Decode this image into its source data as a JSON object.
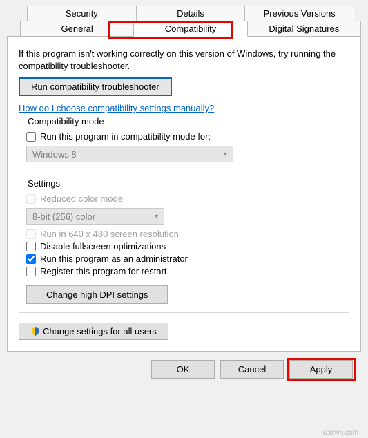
{
  "tabs": {
    "row1": [
      "Security",
      "Details",
      "Previous Versions"
    ],
    "row2": [
      "General",
      "Compatibility",
      "Digital Signatures"
    ],
    "active": "Compatibility"
  },
  "intro": "If this program isn't working correctly on this version of Windows, try running the compatibility troubleshooter.",
  "troubleshooter_btn": "Run compatibility troubleshooter",
  "manual_link": "How do I choose compatibility settings manually?",
  "compat_mode": {
    "group_title": "Compatibility mode",
    "check_label": "Run this program in compatibility mode for:",
    "check_value": false,
    "combo_value": "Windows 8"
  },
  "settings": {
    "group_title": "Settings",
    "reduced_color": {
      "label": "Reduced color mode",
      "checked": false,
      "enabled": false
    },
    "color_combo": "8-bit (256) color",
    "res_640": {
      "label": "Run in 640 x 480 screen resolution",
      "checked": false,
      "enabled": false
    },
    "disable_fullscreen": {
      "label": "Disable fullscreen optimizations",
      "checked": false,
      "enabled": true
    },
    "run_admin": {
      "label": "Run this program as an administrator",
      "checked": true,
      "enabled": true
    },
    "register_restart": {
      "label": "Register this program for restart",
      "checked": false,
      "enabled": true
    },
    "dpi_btn": "Change high DPI settings"
  },
  "all_users_btn": "Change settings for all users",
  "footer": {
    "ok": "OK",
    "cancel": "Cancel",
    "apply": "Apply"
  },
  "watermark": "wsxwn.com"
}
